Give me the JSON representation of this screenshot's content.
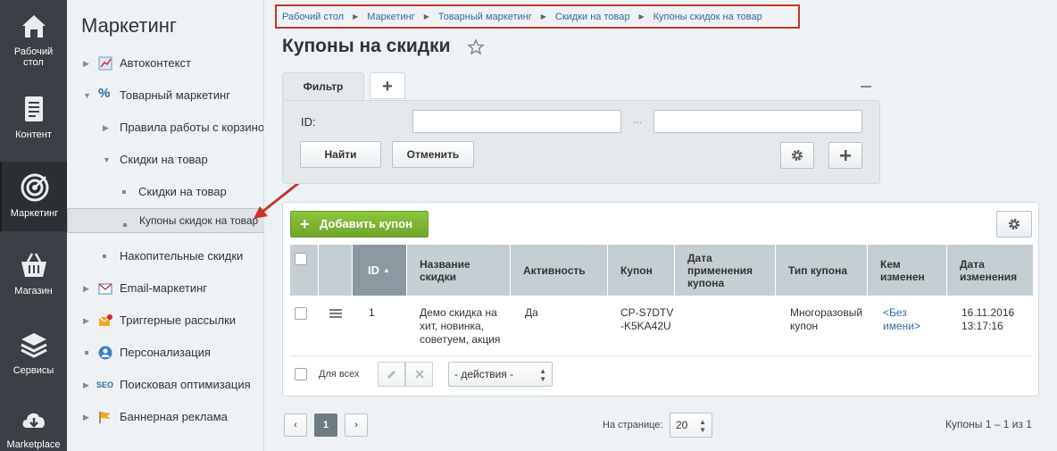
{
  "rail": [
    {
      "label": "Рабочий\nстол",
      "icon": "home-icon"
    },
    {
      "label": "Контент",
      "icon": "document-icon"
    },
    {
      "label": "Маркетинг",
      "icon": "target-icon",
      "active": true
    },
    {
      "label": "Магазин",
      "icon": "basket-icon"
    },
    {
      "label": "Сервисы",
      "icon": "layers-icon"
    },
    {
      "label": "Marketplace",
      "icon": "cloud-download-icon"
    }
  ],
  "menu": {
    "title": "Маркетинг",
    "items": [
      {
        "label": "Автоконтекст"
      },
      {
        "label": "Товарный маркетинг"
      },
      {
        "label": "Правила работы с корзиной"
      },
      {
        "label": "Скидки на товар"
      },
      {
        "label": "Скидки на товар"
      },
      {
        "label": "Купоны скидок на товар"
      },
      {
        "label": "Накопительные скидки"
      },
      {
        "label": "Email-маркетинг"
      },
      {
        "label": "Триггерные рассылки"
      },
      {
        "label": "Персонализация"
      },
      {
        "label": "Поисковая оптимизация"
      },
      {
        "label": "Баннерная реклама"
      }
    ]
  },
  "breadcrumb": [
    "Рабочий стол",
    "Маркетинг",
    "Товарный маркетинг",
    "Скидки на товар",
    "Купоны скидок на товар"
  ],
  "page_title": "Купоны на скидки",
  "filter": {
    "tab_label": "Фильтр",
    "add_tab": "+",
    "id_label": "ID:",
    "range_sep": "...",
    "find_label": "Найти",
    "cancel_label": "Отменить"
  },
  "grid": {
    "add_label": "Добавить купон",
    "columns": [
      "ID",
      "Название скидки",
      "Активность",
      "Купон",
      "Дата применения купона",
      "Тип купона",
      "Кем изменен",
      "Дата изменения"
    ],
    "row": {
      "id": "1",
      "name": "Демо скидка на хит, новинка, советуем, акция",
      "active": "Да",
      "coupon": "CP-S7DTV-K5KA42U",
      "applied": "",
      "type": "Многоразовый купон",
      "modified_by": "<Без имени>",
      "modified_at": "16.11.2016 13:17:16"
    },
    "for_all": "Для всех",
    "actions_label": "- действия -"
  },
  "pager": {
    "prev": "‹",
    "current": "1",
    "next": "›",
    "per_page_label": "На странице:",
    "per_page": "20",
    "summary": "Купоны 1 – 1 из 1"
  },
  "colors": {
    "accent_green": "#7bb536",
    "link": "#2f6aa6",
    "highlight_border": "#c7342a"
  }
}
